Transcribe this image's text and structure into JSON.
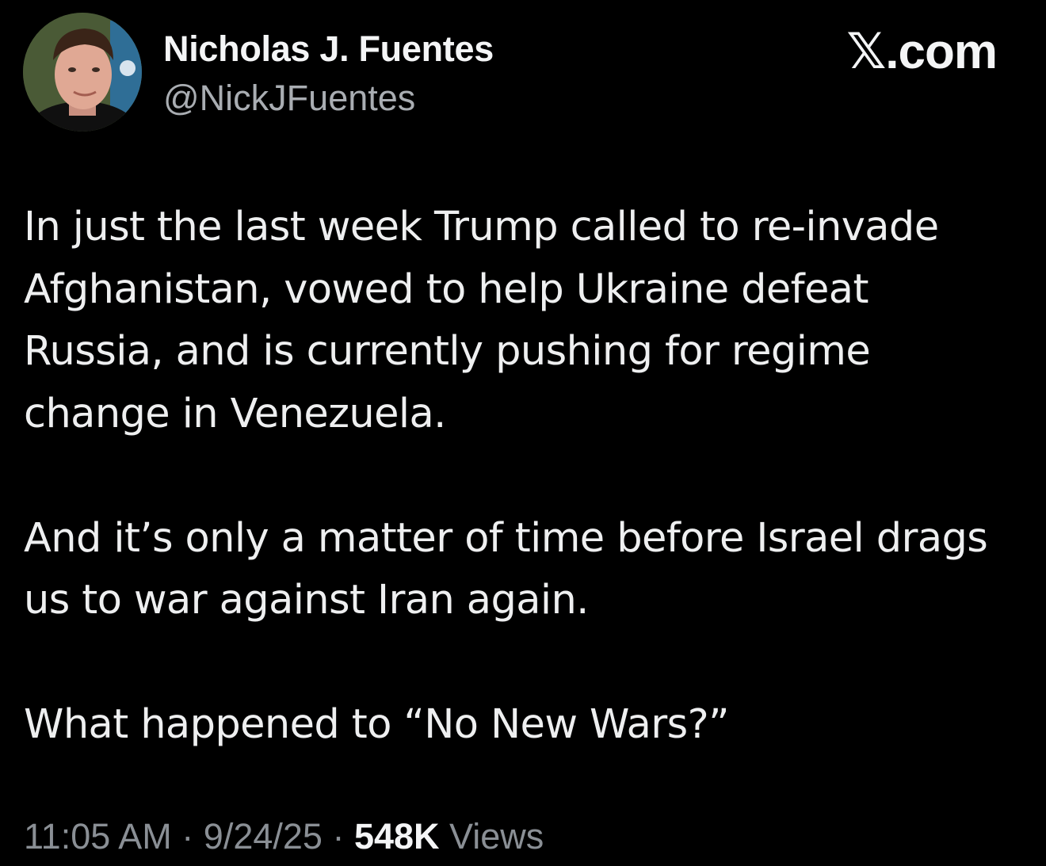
{
  "author": {
    "display_name": "Nicholas J. Fuentes",
    "handle": "@NickJFuentes",
    "avatar_icon": "profile-photo"
  },
  "brand": {
    "label": "𝕏.com"
  },
  "tweet": {
    "paragraphs": [
      {
        "lines": [
          "In just the last week Trump called to re-invade",
          "Afghanistan, vowed to help Ukraine defeat",
          "Russia, and is currently pushing for regime",
          "change in Venezuela."
        ]
      },
      {
        "lines": [
          "And it’s only a matter of time before Israel drags",
          "us to war against Iran again."
        ]
      },
      {
        "lines": [
          "What happened to “No New Wars?”"
        ]
      }
    ]
  },
  "meta": {
    "time": "11:05 AM",
    "separator": " · ",
    "date": "9/24/25",
    "views_count": "548K",
    "views_label": "Views"
  },
  "colors": {
    "background": "#000000",
    "primary_text": "#eeeff0",
    "secondary_text": "#8a8f95"
  }
}
